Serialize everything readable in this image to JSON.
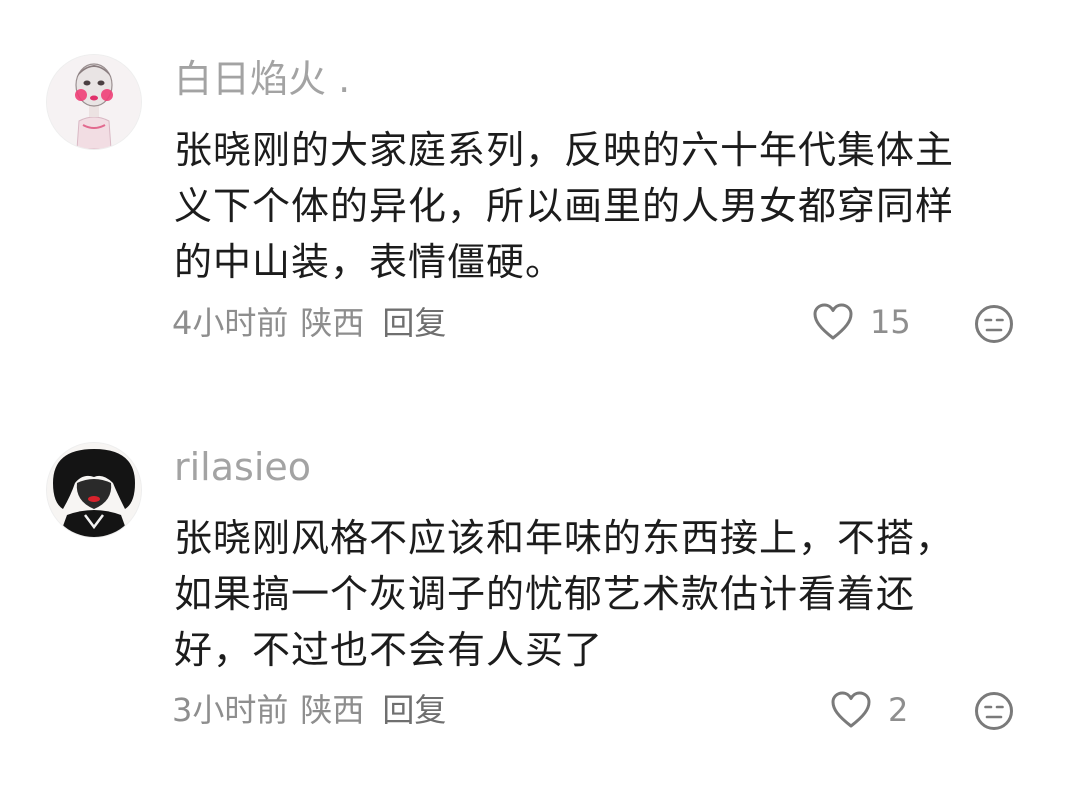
{
  "comments": [
    {
      "username": "白日焰火 .",
      "text_lines": [
        "张晓刚的大家庭系列，反映的六十年代集体主",
        "义下个体的异化，所以画里的人男女都穿同样",
        "的中山装，表情僵硬。"
      ],
      "time": "4小时前",
      "location": "陕西",
      "reply_label": "回复",
      "like_count": "15",
      "avatar_icon": "pink-figure-avatar",
      "like_icon": "heart-outline-icon",
      "emoji_icon": "face-emoji-icon"
    },
    {
      "username": "rilasieo",
      "text_lines": [
        "张晓刚风格不应该和年味的东西接上，不搭，",
        "如果搞一个灰调子的忧郁艺术款估计看着还",
        "好，不过也不会有人买了"
      ],
      "time": "3小时前",
      "location": "陕西",
      "reply_label": "回复",
      "like_count": "2",
      "avatar_icon": "ink-portrait-avatar",
      "like_icon": "heart-outline-icon",
      "emoji_icon": "face-emoji-icon"
    }
  ],
  "colors": {
    "username": "#a3a3a3",
    "text": "#1c1c1c",
    "meta": "#8e8e8e",
    "icon": "#7a7a7a"
  }
}
